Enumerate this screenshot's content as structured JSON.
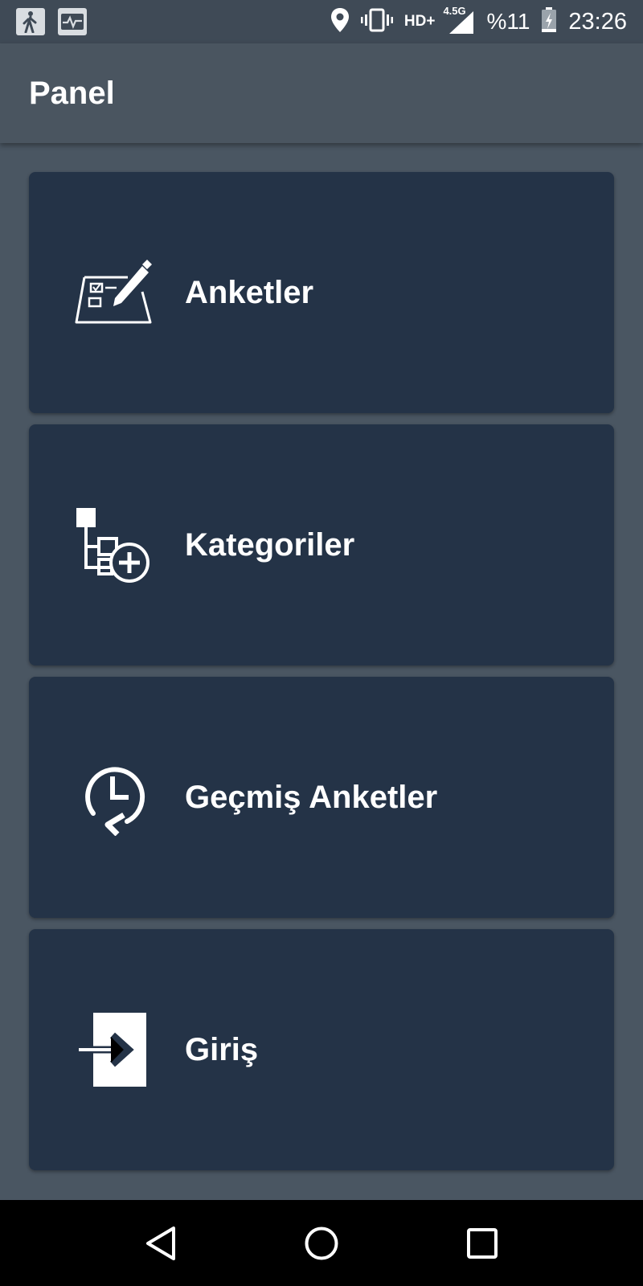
{
  "status_bar": {
    "left_icons": [
      "walking-icon",
      "activity-icon"
    ],
    "network": "HD+",
    "network_type": "4.5G",
    "battery_percent": "%11",
    "time": "23:26",
    "icons": [
      "location-icon",
      "vibrate-icon",
      "signal-icon",
      "battery-charging-icon"
    ]
  },
  "app_bar": {
    "title": "Panel"
  },
  "menu": {
    "items": [
      {
        "label": "Anketler",
        "icon": "survey-edit-icon"
      },
      {
        "label": "Kategoriler",
        "icon": "category-add-icon"
      },
      {
        "label": "Geçmiş Anketler",
        "icon": "history-clock-icon"
      },
      {
        "label": "Giriş",
        "icon": "sign-in-icon"
      }
    ]
  },
  "nav_bar": {
    "buttons": [
      "back-icon",
      "home-icon",
      "recents-icon"
    ]
  },
  "colors": {
    "background": "#4a5662",
    "card": "#243347",
    "app_bar": "#4a5560",
    "text": "#ffffff"
  }
}
